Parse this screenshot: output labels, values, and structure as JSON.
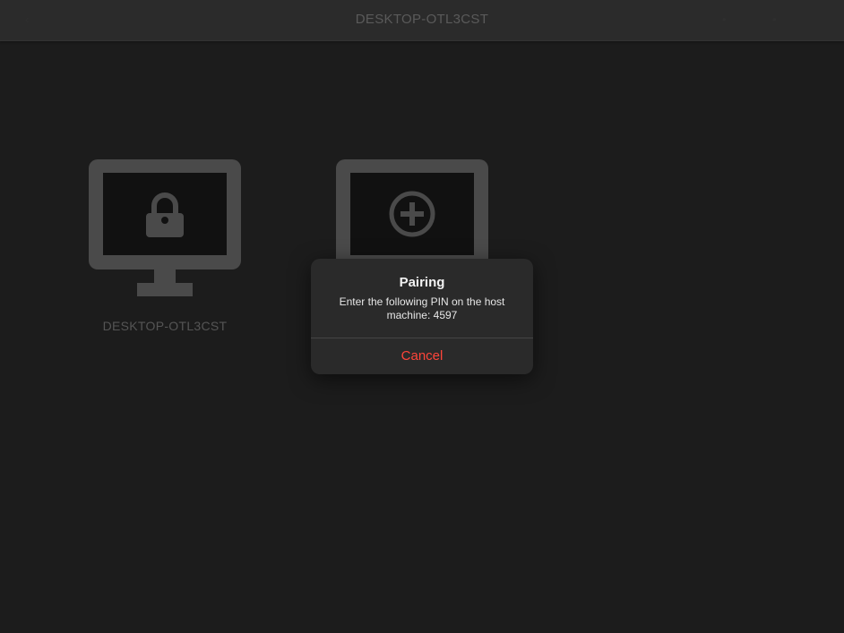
{
  "header": {
    "title": "DESKTOP-OTL3CST"
  },
  "hosts": [
    {
      "name": "DESKTOP-OTL3CST",
      "status_icon": "lock-icon"
    },
    {
      "name": "",
      "status_icon": "plus-circle-icon"
    }
  ],
  "dialog": {
    "title": "Pairing",
    "message": "Enter the following PIN on the host machine: 4597",
    "cancel_label": "Cancel"
  },
  "colors": {
    "background": "#1c1c1c",
    "top_bar": "#2b2b2b",
    "monitor": "#4a4a4a",
    "screen": "#111111",
    "dialog_bg": "#2a2a2a",
    "cancel": "#ff453a"
  }
}
